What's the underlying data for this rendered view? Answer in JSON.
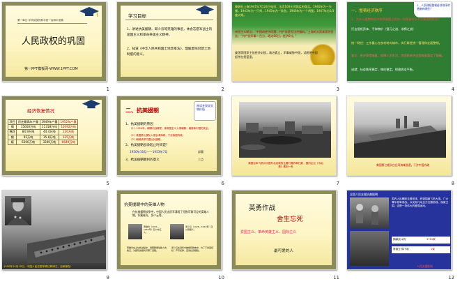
{
  "slides": [
    {
      "number": "1",
      "subtitle_lines": "第一单元  中华民族的和平统一及和平发展",
      "title": "人民政权的巩固",
      "footer": "第一PPT模板网-WWW.1PPT.COM"
    },
    {
      "number": "2",
      "heading": "学习目标",
      "item1": "1、讲述抗美援朝、邱少云等英雄的事迹，体会志愿军战士的爱国主义和革命英雄主义精神。",
      "item2": "2、知道《中华人民共和国土地改革法》，理解废除封建土地制度的意义。"
    },
    {
      "number": "3",
      "text1": "美联社上海1947年7月24日电讯：法币100元可购买的食品，1940年为一头猪，1943年为一只鸡，1945年为一条鱼，1946年为一个鸡蛋，1947年为1/3盒火柴。",
      "text2": "帝国主义断言：“中国的经济问题，共产党是无法克服的。”上海的大资本家则宣告：“共产党军事一百分，政治80分，经济0分。”",
      "text3": "美国等国家主张经济封锁，政治孤立，军事威胁中国，试图把中国扼杀在摇篮里。"
    },
    {
      "number": "4",
      "badge": "2、人民政权整顿经济秩序的措施有哪些？",
      "heading": "一、整顿经济秩序",
      "q1": "1、为什么要整顿经济秩序建国之初的一项既复杂又十分紧迫的任务？",
      "a1": "打击投机资本、平抑物价（银元之战、米棉之战）",
      "a2": "统一财经：工作重心在农村转向城市，实行财经统一管理和全面整顿。",
      "a3": "意义：经济获得恢复，保障人民生活，为国民经济全面恢复奠定了基础。",
      "a4": "成就：社会秩序稳定，物价稳定，财政收支平衡。"
    },
    {
      "number": "5",
      "title": "经济恢复情况",
      "headers": [
        "项目",
        "历史最高年产量",
        "1949年产量",
        "1952年产量"
      ],
      "rows": [
        [
          "钢",
          "15000万吨",
          "11318万吨",
          "16392万吨"
        ],
        [
          "棉花",
          "84.9万吨",
          "44.4万吨",
          "130万吨"
        ],
        [
          "钢",
          "92万吨",
          "15.8万吨",
          "135万吨"
        ],
        [
          "煤",
          "6200万吨",
          "3200万吨",
          "6649万吨"
        ]
      ]
    },
    {
      "number": "6",
      "title": "二、抗美援朝",
      "sticker": "阅读并说说文物价值",
      "h1": "1、抗美援朝的原因",
      "p1": "（1）1950年，朝鲜内战爆发，美帝国主义入侵朝鲜，威胁新中国的安全。",
      "p2": "（2）美国第七舰队入侵台湾海峡，干涉我国内政。",
      "p3": "（3）朝鲜请求中国出兵援助。",
      "h2": "2、抗美援朝战争起止时间是？",
      "dates": "1950年10月——1953年7月",
      "h3": "3、抗美援朝胜利的意义",
      "side1": "部署",
      "side2": "三点"
    },
    {
      "number": "7",
      "caption": "美国空军飞机对中国东北边境的主要行轰炸和扫射，国内企业《今后是》遭到一系"
    },
    {
      "number": "8",
      "caption": "美国第七舰队在台湾海域巡逻，干涉中国内政"
    },
    {
      "number": "9",
      "caption": "1950年10月19日，中国人民志愿军跨过鸭绿江，赴朝参战"
    },
    {
      "number": "10",
      "heading": "抗美援朝中的英雄人物",
      "intro": "在抗美援朝战争中，中国人民志愿军涌现了无数可歌可泣的英雄人物，如黄继光、邱少云等。",
      "hero1": "黄继光（1931—1952年）四川中江人。",
      "hero2": "邱少云（1926—1952年）四川铜梁人。",
      "desc1": "黄继光在上甘岭战役中，用胸膛堵住敌人的枪口，为部队的胜利开辟了道路。",
      "desc2": "邱少云在潜伏中被燃烧弹击中，为了不暴露目标，严守纪律，直到壮烈牺牲。"
    },
    {
      "number": "11",
      "title": "英勇作战",
      "subtitle": "舍生忘死",
      "spirit": "爱国主义、革命英雄主义、国际主义",
      "footer": "最可爱的人"
    },
    {
      "number": "12",
      "heading": "全国人民支援抗美援朝",
      "text": "国内人民踊跃支援前线，积极捐献飞机大炮，广大青年参军参战。以实际行动全力支援前线，保家卫国，这是一场伟大的爱国运动。",
      "label1": "捐献战斗机",
      "value1": "3710架",
      "label2": "常香玉·捐飞机",
      "value2": "1架",
      "footer": "人民支援前线"
    }
  ],
  "colors": {
    "red": "#c00000",
    "blue": "#1a33aa",
    "frame": "#8c8c5a",
    "green_bg": "#2f7a2c",
    "blue_bg": "#27339c",
    "highlight": "#e0245e"
  }
}
